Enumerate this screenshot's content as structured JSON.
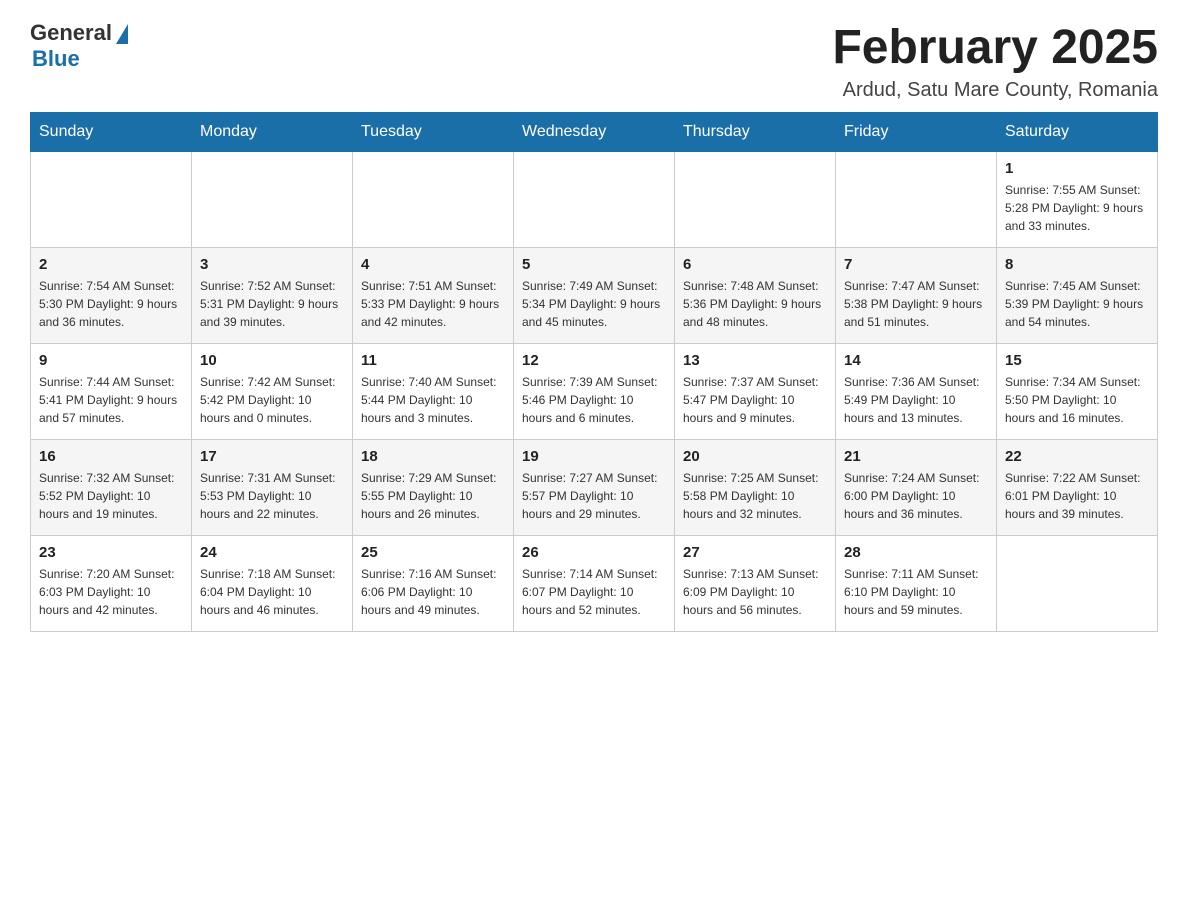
{
  "header": {
    "logo_general": "General",
    "logo_blue": "Blue",
    "title": "February 2025",
    "subtitle": "Ardud, Satu Mare County, Romania"
  },
  "days_of_week": [
    "Sunday",
    "Monday",
    "Tuesday",
    "Wednesday",
    "Thursday",
    "Friday",
    "Saturday"
  ],
  "weeks": [
    [
      {
        "day": "",
        "info": ""
      },
      {
        "day": "",
        "info": ""
      },
      {
        "day": "",
        "info": ""
      },
      {
        "day": "",
        "info": ""
      },
      {
        "day": "",
        "info": ""
      },
      {
        "day": "",
        "info": ""
      },
      {
        "day": "1",
        "info": "Sunrise: 7:55 AM\nSunset: 5:28 PM\nDaylight: 9 hours and 33 minutes."
      }
    ],
    [
      {
        "day": "2",
        "info": "Sunrise: 7:54 AM\nSunset: 5:30 PM\nDaylight: 9 hours and 36 minutes."
      },
      {
        "day": "3",
        "info": "Sunrise: 7:52 AM\nSunset: 5:31 PM\nDaylight: 9 hours and 39 minutes."
      },
      {
        "day": "4",
        "info": "Sunrise: 7:51 AM\nSunset: 5:33 PM\nDaylight: 9 hours and 42 minutes."
      },
      {
        "day": "5",
        "info": "Sunrise: 7:49 AM\nSunset: 5:34 PM\nDaylight: 9 hours and 45 minutes."
      },
      {
        "day": "6",
        "info": "Sunrise: 7:48 AM\nSunset: 5:36 PM\nDaylight: 9 hours and 48 minutes."
      },
      {
        "day": "7",
        "info": "Sunrise: 7:47 AM\nSunset: 5:38 PM\nDaylight: 9 hours and 51 minutes."
      },
      {
        "day": "8",
        "info": "Sunrise: 7:45 AM\nSunset: 5:39 PM\nDaylight: 9 hours and 54 minutes."
      }
    ],
    [
      {
        "day": "9",
        "info": "Sunrise: 7:44 AM\nSunset: 5:41 PM\nDaylight: 9 hours and 57 minutes."
      },
      {
        "day": "10",
        "info": "Sunrise: 7:42 AM\nSunset: 5:42 PM\nDaylight: 10 hours and 0 minutes."
      },
      {
        "day": "11",
        "info": "Sunrise: 7:40 AM\nSunset: 5:44 PM\nDaylight: 10 hours and 3 minutes."
      },
      {
        "day": "12",
        "info": "Sunrise: 7:39 AM\nSunset: 5:46 PM\nDaylight: 10 hours and 6 minutes."
      },
      {
        "day": "13",
        "info": "Sunrise: 7:37 AM\nSunset: 5:47 PM\nDaylight: 10 hours and 9 minutes."
      },
      {
        "day": "14",
        "info": "Sunrise: 7:36 AM\nSunset: 5:49 PM\nDaylight: 10 hours and 13 minutes."
      },
      {
        "day": "15",
        "info": "Sunrise: 7:34 AM\nSunset: 5:50 PM\nDaylight: 10 hours and 16 minutes."
      }
    ],
    [
      {
        "day": "16",
        "info": "Sunrise: 7:32 AM\nSunset: 5:52 PM\nDaylight: 10 hours and 19 minutes."
      },
      {
        "day": "17",
        "info": "Sunrise: 7:31 AM\nSunset: 5:53 PM\nDaylight: 10 hours and 22 minutes."
      },
      {
        "day": "18",
        "info": "Sunrise: 7:29 AM\nSunset: 5:55 PM\nDaylight: 10 hours and 26 minutes."
      },
      {
        "day": "19",
        "info": "Sunrise: 7:27 AM\nSunset: 5:57 PM\nDaylight: 10 hours and 29 minutes."
      },
      {
        "day": "20",
        "info": "Sunrise: 7:25 AM\nSunset: 5:58 PM\nDaylight: 10 hours and 32 minutes."
      },
      {
        "day": "21",
        "info": "Sunrise: 7:24 AM\nSunset: 6:00 PM\nDaylight: 10 hours and 36 minutes."
      },
      {
        "day": "22",
        "info": "Sunrise: 7:22 AM\nSunset: 6:01 PM\nDaylight: 10 hours and 39 minutes."
      }
    ],
    [
      {
        "day": "23",
        "info": "Sunrise: 7:20 AM\nSunset: 6:03 PM\nDaylight: 10 hours and 42 minutes."
      },
      {
        "day": "24",
        "info": "Sunrise: 7:18 AM\nSunset: 6:04 PM\nDaylight: 10 hours and 46 minutes."
      },
      {
        "day": "25",
        "info": "Sunrise: 7:16 AM\nSunset: 6:06 PM\nDaylight: 10 hours and 49 minutes."
      },
      {
        "day": "26",
        "info": "Sunrise: 7:14 AM\nSunset: 6:07 PM\nDaylight: 10 hours and 52 minutes."
      },
      {
        "day": "27",
        "info": "Sunrise: 7:13 AM\nSunset: 6:09 PM\nDaylight: 10 hours and 56 minutes."
      },
      {
        "day": "28",
        "info": "Sunrise: 7:11 AM\nSunset: 6:10 PM\nDaylight: 10 hours and 59 minutes."
      },
      {
        "day": "",
        "info": ""
      }
    ]
  ]
}
